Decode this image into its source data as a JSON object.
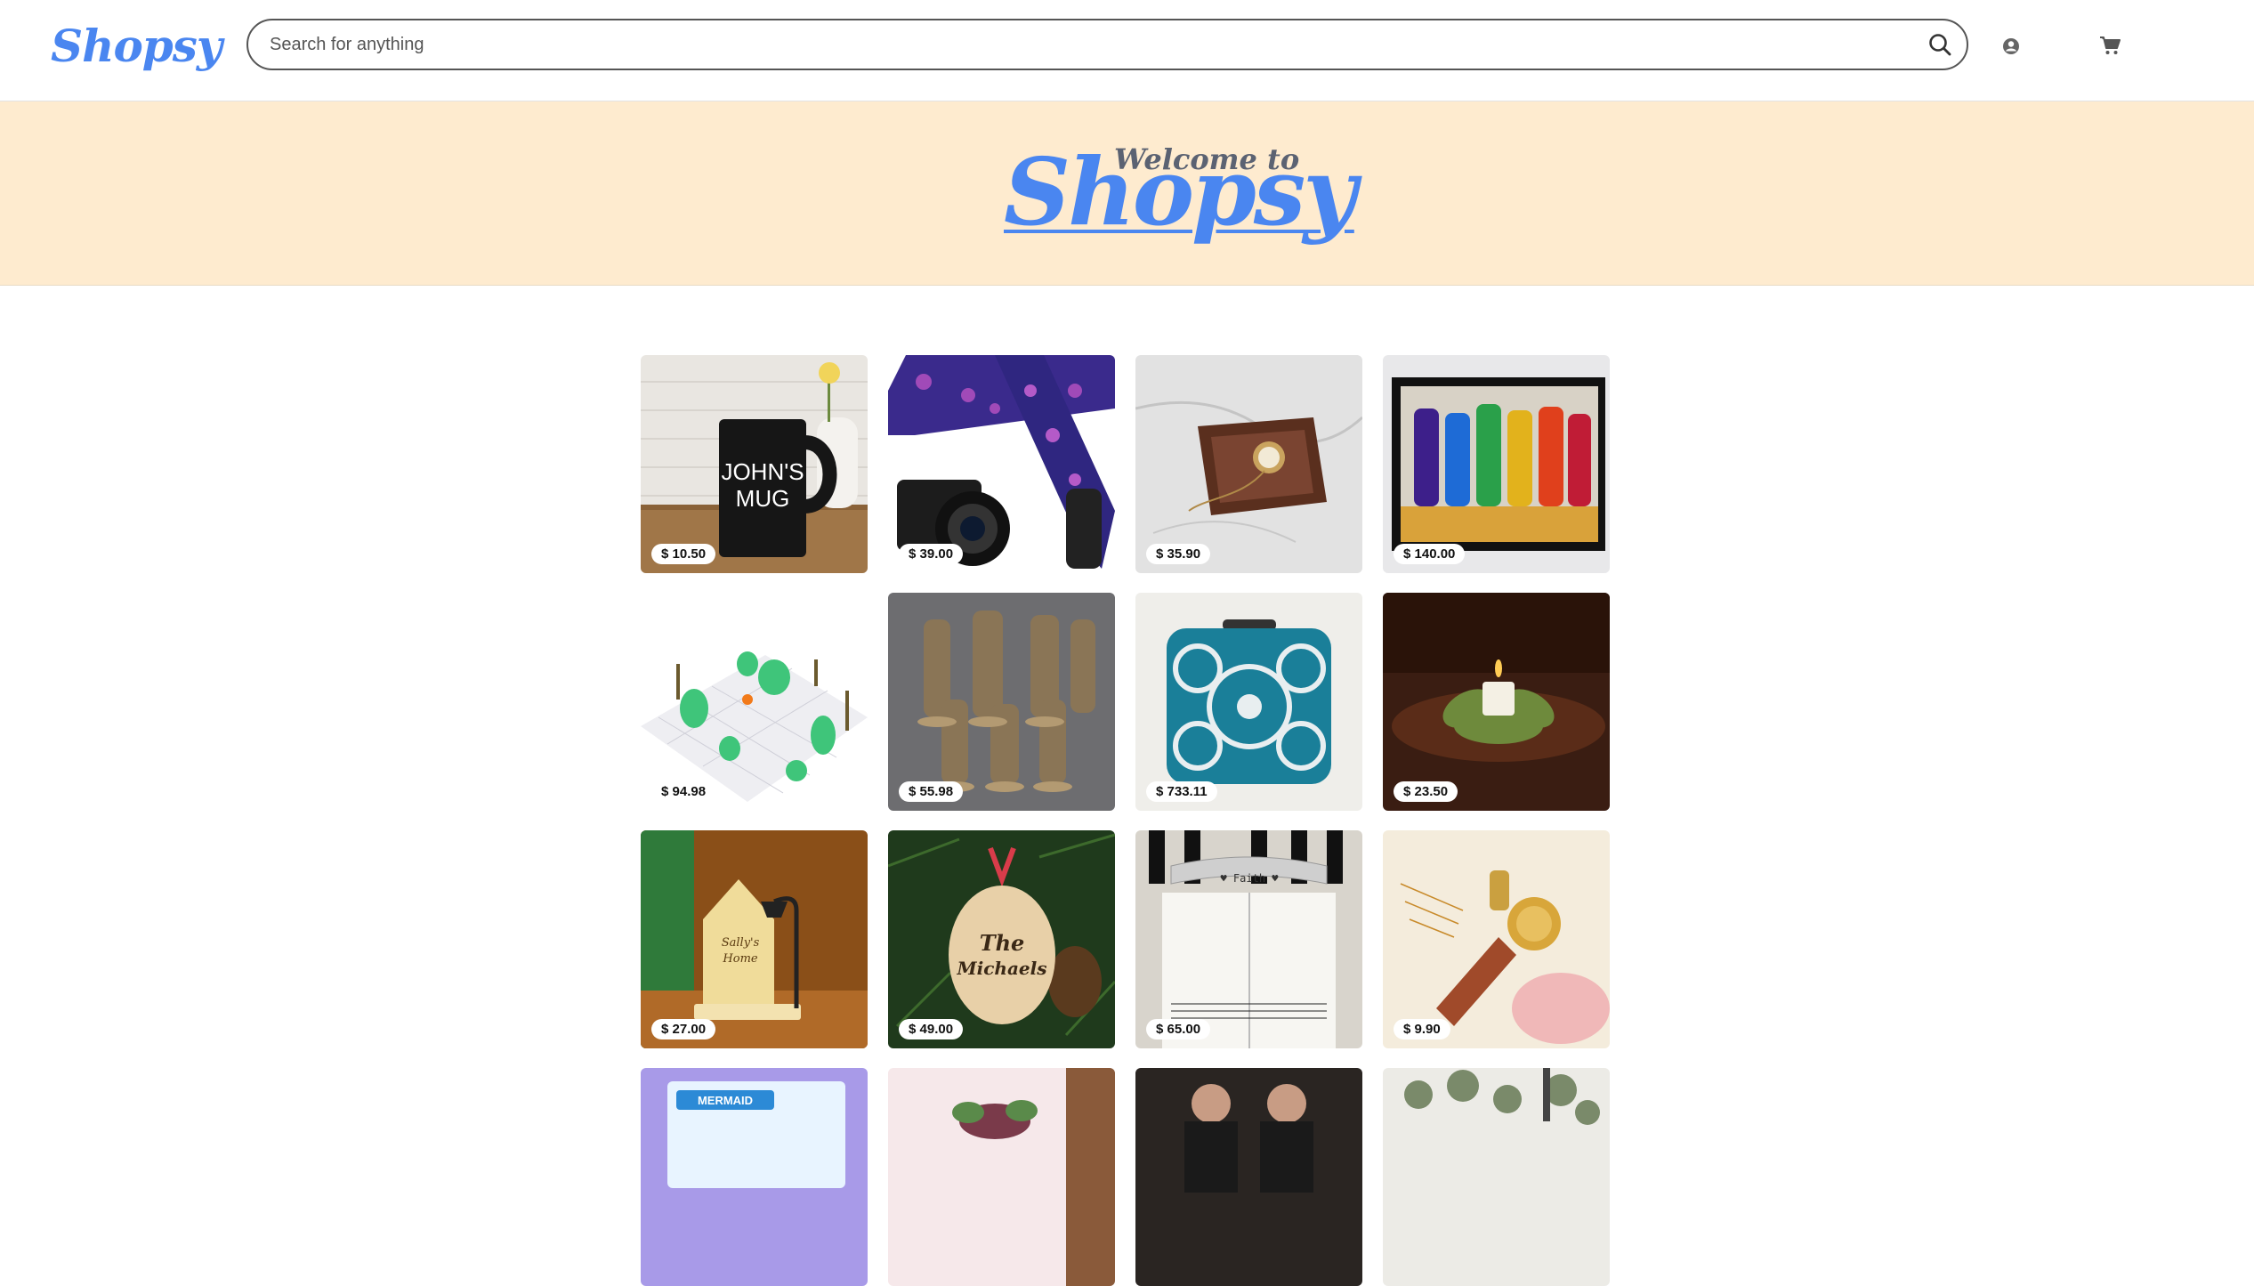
{
  "header": {
    "logo": "Shopsy",
    "search_placeholder": "Search for anything",
    "search_value": ""
  },
  "banner": {
    "welcome": "Welcome to",
    "brand": "Shopsy"
  },
  "colors": {
    "brand": "#4a86f0",
    "banner_bg": "#feebcf"
  },
  "icons": {
    "search": "search-icon",
    "account": "account-icon",
    "cart": "cart-icon"
  },
  "products": [
    {
      "price": "$ 10.50",
      "image": "black-mug",
      "image_text": "JOHN'S MUG"
    },
    {
      "price": "$ 39.00",
      "image": "camera-strap"
    },
    {
      "price": "$ 35.90",
      "image": "leather-tray"
    },
    {
      "price": "$ 140.00",
      "image": "stained-glass-cats"
    },
    {
      "price": "$ 94.98",
      "image": "miniature-terrain"
    },
    {
      "price": "$ 55.98",
      "image": "samurai-miniatures"
    },
    {
      "price": "$ 733.11",
      "image": "beaded-clutch"
    },
    {
      "price": "$ 23.50",
      "image": "lotus-candle"
    },
    {
      "price": "$ 27.00",
      "image": "house-lamp",
      "image_text": "Sally's Home"
    },
    {
      "price": "$ 49.00",
      "image": "wood-ornament",
      "image_text": "The Michaels"
    },
    {
      "price": "$ 65.00",
      "image": "book-holder",
      "image_text": "♥ Faith ♥"
    },
    {
      "price": "$ 9.90",
      "image": "wax-seal"
    },
    {
      "price": "",
      "image": "mermaid-box",
      "image_text": "MERMAID"
    },
    {
      "price": "",
      "image": "succulent"
    },
    {
      "price": "",
      "image": "portrait-photo"
    },
    {
      "price": "",
      "image": "dried-flowers"
    }
  ]
}
